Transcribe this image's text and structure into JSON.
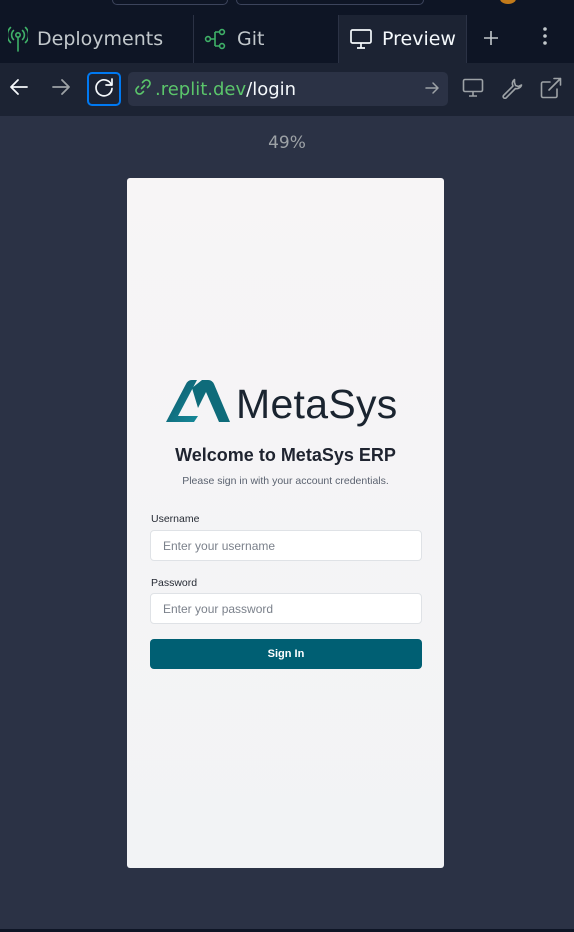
{
  "tabs": {
    "deployments": {
      "label": "Deployments",
      "icon": "deployments-icon"
    },
    "git": {
      "label": "Git",
      "icon": "git-icon"
    },
    "preview": {
      "label": "Preview",
      "icon": "monitor-icon",
      "active": true
    },
    "add_icon": "plus-icon",
    "more_icon": "kebab-icon"
  },
  "urlbar": {
    "host": ".replit.dev",
    "path": "/login",
    "back_icon": "arrow-left-icon",
    "forward_icon": "arrow-right-icon",
    "reload_icon": "reload-icon",
    "link_icon": "link-icon",
    "go_icon": "arrow-right-icon",
    "device_icon": "monitor-icon",
    "devtools_icon": "wrench-icon",
    "external_icon": "external-link-icon"
  },
  "zoom": "49%",
  "login": {
    "brand": "MetaSys",
    "heading": "Welcome to MetaSys ERP",
    "subtitle": "Please sign in with your account credentials.",
    "username_label": "Username",
    "username_placeholder": "Enter your username",
    "password_label": "Password",
    "password_placeholder": "Enter your password",
    "submit_label": "Sign In"
  },
  "colors": {
    "accent": "#0079f2",
    "url_host": "#5bc56b",
    "brand_teal": "#0e6b7a",
    "button": "#005f73"
  }
}
